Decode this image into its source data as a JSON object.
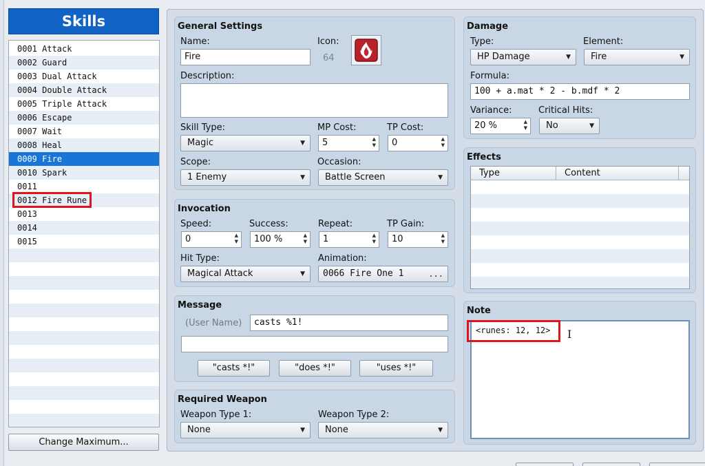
{
  "skills_panel": {
    "title": "Skills",
    "items": [
      "0001 Attack",
      "0002 Guard",
      "0003 Dual Attack",
      "0004 Double Attack",
      "0005 Triple Attack",
      "0006 Escape",
      "0007 Wait",
      "0008 Heal",
      "0009 Fire",
      "0010 Spark",
      "0011",
      "0012 Fire Rune",
      "0013",
      "0014",
      "0015"
    ],
    "selected_index": 8,
    "highlighted_index": 11,
    "change_max_label": "Change Maximum..."
  },
  "general": {
    "title": "General Settings",
    "name_label": "Name:",
    "name_value": "Fire",
    "icon_label": "Icon:",
    "icon_index": "64",
    "description_label": "Description:",
    "description_value": "",
    "skill_type_label": "Skill Type:",
    "skill_type_value": "Magic",
    "mp_cost_label": "MP Cost:",
    "mp_cost_value": "5",
    "tp_cost_label": "TP Cost:",
    "tp_cost_value": "0",
    "scope_label": "Scope:",
    "scope_value": "1 Enemy",
    "occasion_label": "Occasion:",
    "occasion_value": "Battle Screen"
  },
  "invocation": {
    "title": "Invocation",
    "speed_label": "Speed:",
    "speed_value": "0",
    "success_label": "Success:",
    "success_value": "100 %",
    "repeat_label": "Repeat:",
    "repeat_value": "1",
    "tp_gain_label": "TP Gain:",
    "tp_gain_value": "10",
    "hit_type_label": "Hit Type:",
    "hit_type_value": "Magical Attack",
    "animation_label": "Animation:",
    "animation_value": "0066 Fire One 1",
    "animation_more": "..."
  },
  "message": {
    "title": "Message",
    "user_name": "(User Name)",
    "line1": "casts %1!",
    "line2": "",
    "btn_casts": "\"casts *!\"",
    "btn_does": "\"does *!\"",
    "btn_uses": "\"uses *!\""
  },
  "required_weapon": {
    "title": "Required Weapon",
    "type1_label": "Weapon Type 1:",
    "type1_value": "None",
    "type2_label": "Weapon Type 2:",
    "type2_value": "None"
  },
  "damage": {
    "title": "Damage",
    "type_label": "Type:",
    "type_value": "HP Damage",
    "element_label": "Element:",
    "element_value": "Fire",
    "formula_label": "Formula:",
    "formula_value": "100 + a.mat * 2 - b.mdf * 2",
    "variance_label": "Variance:",
    "variance_value": "20 %",
    "critical_label": "Critical Hits:",
    "critical_value": "No"
  },
  "effects": {
    "title": "Effects",
    "col_type": "Type",
    "col_content": "Content"
  },
  "note": {
    "title": "Note",
    "value": "<runes: 12, 12>"
  },
  "colors": {
    "selection": "#1976d6",
    "header": "#1062c4",
    "annotation_red": "#e0141c"
  }
}
